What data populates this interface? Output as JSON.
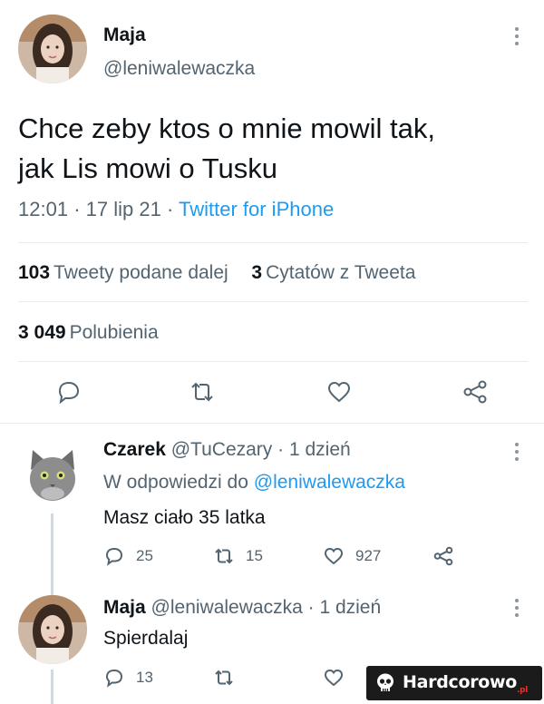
{
  "main_tweet": {
    "author_name": "Maja",
    "author_handle": "@leniwalewaczka",
    "text_line1": "Chce zeby ktos o mnie mowil tak,",
    "text_line2": "jak Lis mowi o Tusku",
    "time": "12:01",
    "date": "17 lip 21",
    "source": "Twitter for iPhone",
    "retweets_count": "103",
    "retweets_label": "Tweety podane dalej",
    "quotes_count": "3",
    "quotes_label": "Cytatów z Tweeta",
    "likes_count": "3 049",
    "likes_label": "Polubienia"
  },
  "replies": [
    {
      "author_name": "Czarek",
      "author_handle": "@TuCezary",
      "age": "1 dzień",
      "reply_to_prefix": "W odpowiedzi do",
      "reply_to_handle": "@leniwalewaczka",
      "text": "Masz ciało 35 latka",
      "reply_count": "25",
      "retweet_count": "15",
      "like_count": "927"
    },
    {
      "author_name": "Maja",
      "author_handle": "@leniwalewaczka",
      "age": "1 dzień",
      "text": "Spierdalaj",
      "reply_count": "13"
    }
  ],
  "separator": "·",
  "watermark": {
    "text": "Hardcorowo",
    "suffix": ".pl"
  },
  "colors": {
    "link": "#1d9bf0",
    "secondary_text": "#536471",
    "primary_text": "#0f1419",
    "divider": "#e6ecf0"
  },
  "icons": [
    "reply-icon",
    "retweet-icon",
    "like-icon",
    "share-icon",
    "more-icon",
    "skull-icon"
  ]
}
